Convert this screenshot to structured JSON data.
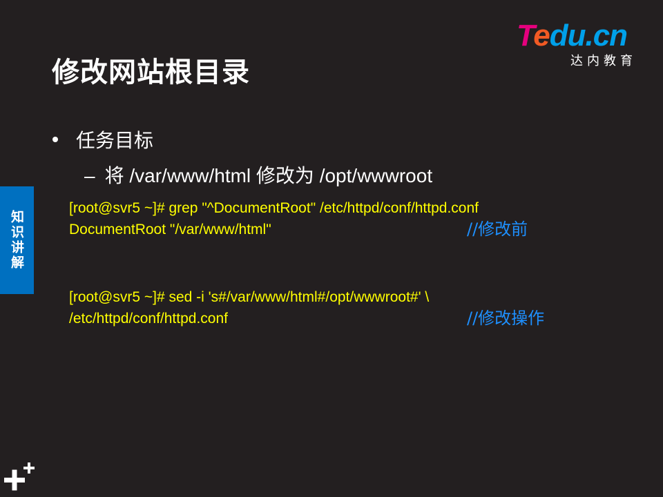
{
  "slide": {
    "title": "修改网站根目录"
  },
  "logo": {
    "brand_t": "T",
    "brand_e": "e",
    "brand_rest": "du.cn",
    "subtitle": "达内教育"
  },
  "sidebar": {
    "tab_label": "知识讲解"
  },
  "content": {
    "bullet_1": "任务目标",
    "bullet_2_dash": "–",
    "bullet_2": "将 /var/www/html  修改为 /opt/wwwroot",
    "block_1": {
      "line_1": "[root@svr5 ~]# grep \"^DocumentRoot\" /etc/httpd/conf/httpd.conf",
      "line_2": "DocumentRoot \"/var/www/html\"",
      "comment": "//修改前"
    },
    "block_2": {
      "line_1": "[root@svr5 ~]# sed -i 's#/var/www/html#/opt/wwwroot#'  \\",
      "line_2": "/etc/httpd/conf/httpd.conf",
      "comment": "//修改操作"
    }
  },
  "colors": {
    "background": "#231f20",
    "code_text": "#ffff00",
    "comment": "#1e90ff",
    "sidebar": "#0070c0",
    "logo_pink": "#e5007e",
    "logo_orange": "#f15a24",
    "logo_blue": "#00a0e9"
  },
  "icons": {
    "bottom_left": "plus-plus-icon"
  }
}
